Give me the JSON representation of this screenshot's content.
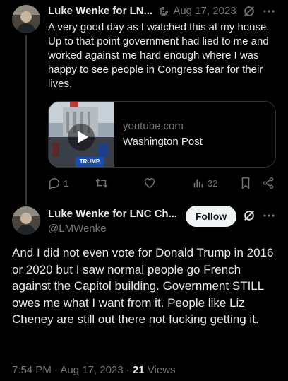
{
  "reply_tweet": {
    "author_name": "Luke Wenke for LN...",
    "bot_icon": "robot-icon",
    "date": "· Aug 17, 2023",
    "text": "A very good day as I watched this at my house.  Up to that point government had lied to me and worked against me hard enough where I was happy to see people in Congress fear for their lives.",
    "card": {
      "domain": "youtube.com",
      "title": "Washington Post"
    },
    "replies": "1",
    "retweets": "",
    "likes": "",
    "views": "32"
  },
  "main_tweet": {
    "author_name": "Luke Wenke for LNC Ch...",
    "handle": "@LMWenke",
    "follow_label": "Follow",
    "text": "And I did not even vote for Donald Trump in 2016 or 2020 but I saw normal people go French against the Capitol building. Government STILL owes me what I want from it.  People like Liz Cheney are still out there not fucking getting it.",
    "time": "7:54 PM · Aug 17, 2023 · ",
    "views_count": "21",
    "views_label": " Views"
  },
  "colors": {
    "background": "#000000",
    "text": "#e7e9ea",
    "muted": "#71767b",
    "border": "#2f3336"
  }
}
